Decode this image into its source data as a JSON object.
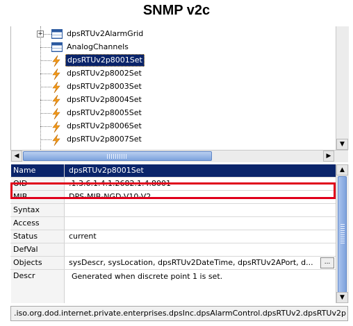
{
  "title": "SNMP v2c",
  "tree": {
    "items": [
      {
        "label": "dpsRTUv2AlarmGrid",
        "icon": "grid-icon",
        "expandable": true,
        "selected": false
      },
      {
        "label": "AnalogChannels",
        "icon": "grid-icon",
        "expandable": false,
        "selected": false
      },
      {
        "label": "dpsRTUv2p8001Set",
        "icon": "notification-bolt-icon",
        "expandable": false,
        "selected": true
      },
      {
        "label": "dpsRTUv2p8002Set",
        "icon": "notification-bolt-icon",
        "expandable": false,
        "selected": false
      },
      {
        "label": "dpsRTUv2p8003Set",
        "icon": "notification-bolt-icon",
        "expandable": false,
        "selected": false
      },
      {
        "label": "dpsRTUv2p8004Set",
        "icon": "notification-bolt-icon",
        "expandable": false,
        "selected": false
      },
      {
        "label": "dpsRTUv2p8005Set",
        "icon": "notification-bolt-icon",
        "expandable": false,
        "selected": false
      },
      {
        "label": "dpsRTUv2p8006Set",
        "icon": "notification-bolt-icon",
        "expandable": false,
        "selected": false
      },
      {
        "label": "dpsRTUv2p8007Set",
        "icon": "notification-bolt-icon",
        "expandable": false,
        "selected": false
      }
    ]
  },
  "properties": [
    {
      "name": "Name",
      "value": "dpsRTUv2p8001Set",
      "selected": true
    },
    {
      "name": "OID",
      "value": ".1.3.6.1.4.1.2682.1.4.8001",
      "highlighted": true
    },
    {
      "name": "MIB",
      "value": "DPS-MIB-NGD-V10-V2"
    },
    {
      "name": "Syntax",
      "value": ""
    },
    {
      "name": "Access",
      "value": ""
    },
    {
      "name": "Status",
      "value": "current"
    },
    {
      "name": "DefVal",
      "value": ""
    },
    {
      "name": "Objects",
      "value": "sysDescr, sysLocation, dpsRTUv2DateTime, dpsRTUv2APort, d...",
      "has_button": true,
      "button_label": "..."
    },
    {
      "name": "Descr",
      "value": "Generated when discrete point 1 is set."
    }
  ],
  "status_path": ".iso.org.dod.internet.private.enterprises.dpsInc.dpsAlarmControl.dpsRTUv2.dpsRTUv2p",
  "colors": {
    "selection": "#0a246a",
    "highlight_box": "#e0001b",
    "scroll_thumb": "#7ea3dd"
  }
}
